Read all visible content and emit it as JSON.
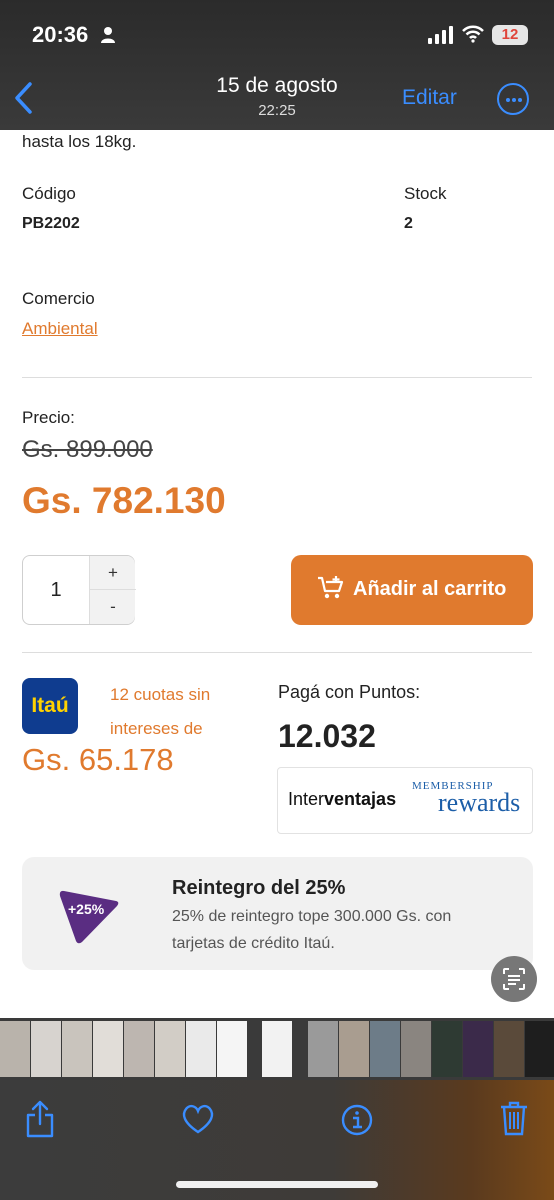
{
  "status_bar": {
    "time": "20:36",
    "battery": "12"
  },
  "nav": {
    "date": "15 de agosto",
    "time": "22:25",
    "edit_label": "Editar"
  },
  "product": {
    "description_tail": "hasta los 18kg.",
    "code_label": "Código",
    "code_value": "PB2202",
    "stock_label": "Stock",
    "stock_value": "2",
    "store_label": "Comercio",
    "store_link": "Ambiental",
    "price_label": "Precio:",
    "old_price": "Gs. 899.000",
    "price": "Gs. 782.130",
    "quantity": "1",
    "plus": "+",
    "minus": "-",
    "add_to_cart": "Añadir al carrito"
  },
  "payment": {
    "itau_logo": "Itaú",
    "cuotas_text": "12 cuotas sin intereses de",
    "cuotas_amount": "Gs. 65.178",
    "puntos_label": "Pagá con Puntos:",
    "puntos_value": "12.032",
    "interventajas_a": "Inter",
    "interventajas_b": "ventajas",
    "membership_top": "MEMBERSHIP",
    "membership_bottom": "rewards"
  },
  "promo": {
    "badge": "+25%",
    "title": "Reintegro del 25%",
    "text": "25% de reintegro tope 300.000 Gs. con tarjetas de crédito Itaú."
  },
  "colors": {
    "accent": "#e07a2e",
    "ios_blue": "#3a8dff",
    "itau_blue": "#0f3c8f",
    "itau_yellow": "#ffd200",
    "promo_purple": "#5a2d82"
  },
  "icons": [
    "back-chevron-icon",
    "more-icon",
    "cart-plus-icon",
    "share-icon",
    "heart-icon",
    "info-icon",
    "trash-icon",
    "live-text-icon"
  ]
}
